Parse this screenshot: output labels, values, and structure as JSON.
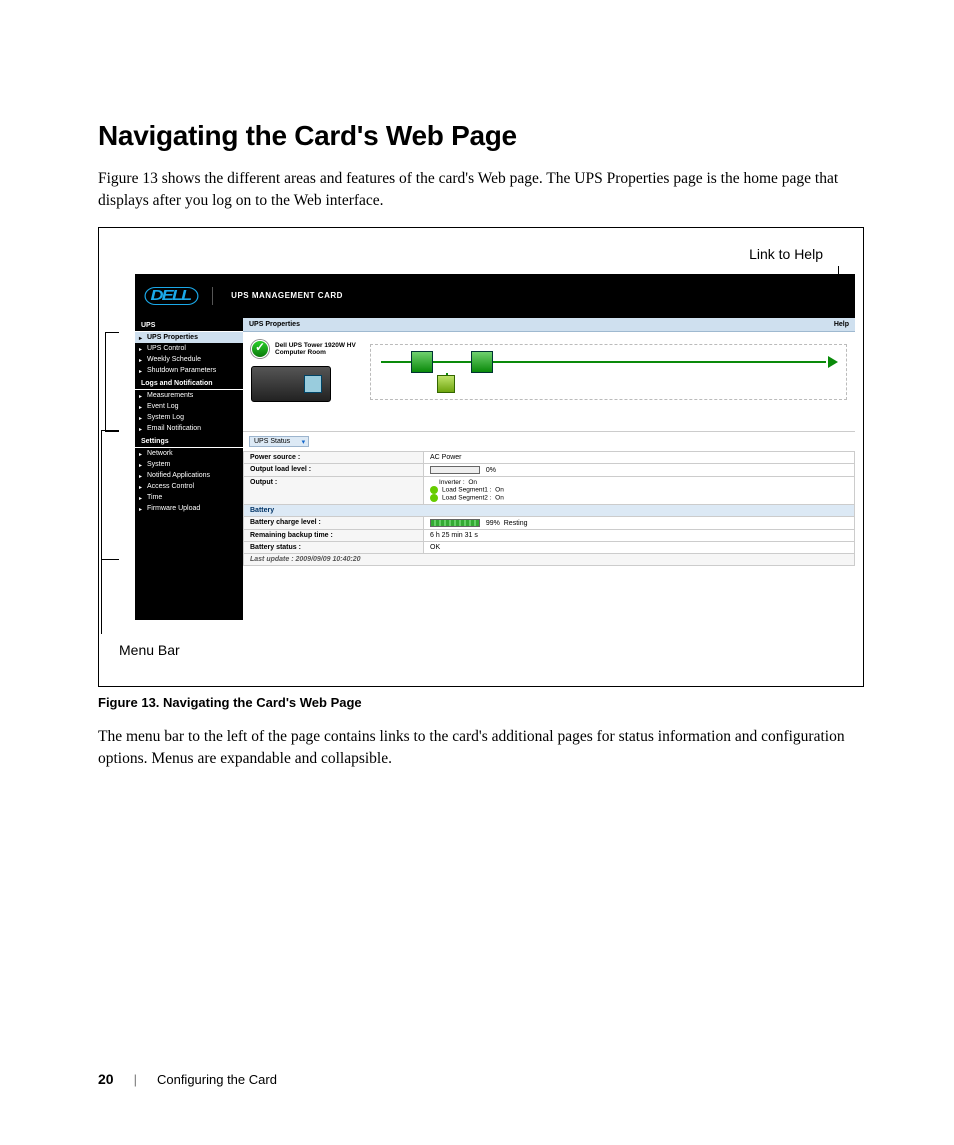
{
  "heading": "Navigating the Card's Web Page",
  "intro": "Figure 13 shows the different areas and features of the card's Web page. The UPS Properties page is the home page that displays after you log on to the Web interface.",
  "figure": {
    "callout_help": "Link to Help",
    "callout_menu": "Menu Bar",
    "caption": "Figure 13. Navigating the Card's Web Page"
  },
  "ui": {
    "logo_text": "DELL",
    "header_title": "UPS MANAGEMENT CARD",
    "content_title": "UPS Properties",
    "help_link": "Help",
    "device_name": "Dell UPS Tower 1920W HV",
    "device_location": "Computer Room",
    "combo_label": "UPS Status",
    "sidebar": {
      "groups": [
        {
          "header": "UPS",
          "items": [
            "UPS Properties",
            "UPS Control",
            "Weekly Schedule",
            "Shutdown Parameters"
          ]
        },
        {
          "header": "Logs and Notification",
          "items": [
            "Measurements",
            "Event Log",
            "System Log",
            "Email Notification"
          ]
        },
        {
          "header": "Settings",
          "items": [
            "Network",
            "System",
            "Notified Applications",
            "Access Control",
            "Time",
            "Firmware Upload"
          ]
        }
      ],
      "active": "UPS Properties"
    },
    "rows": {
      "power_source_label": "Power source :",
      "power_source_value": "AC Power",
      "output_load_label": "Output load level :",
      "output_load_value": "0%",
      "output_label": "Output :",
      "inverter_label": "Inverter :",
      "inverter_value": "On",
      "ls1_label": "Load Segment1 :",
      "ls1_value": "On",
      "ls2_label": "Load Segment2 :",
      "ls2_value": "On",
      "battery_section": "Battery",
      "charge_label": "Battery charge level :",
      "charge_value": "99%",
      "charge_state": "Resting",
      "backup_label": "Remaining backup time :",
      "backup_value": "6 h 25 min 31 s",
      "status_label": "Battery status :",
      "status_value": "OK",
      "last_update": "Last update : 2009/09/09 10:40:20"
    }
  },
  "body2": "The menu bar to the left of the page contains links to the card's additional pages for status information and configuration options. Menus are expandable and collapsible.",
  "footer": {
    "page": "20",
    "section": "Configuring the Card"
  }
}
